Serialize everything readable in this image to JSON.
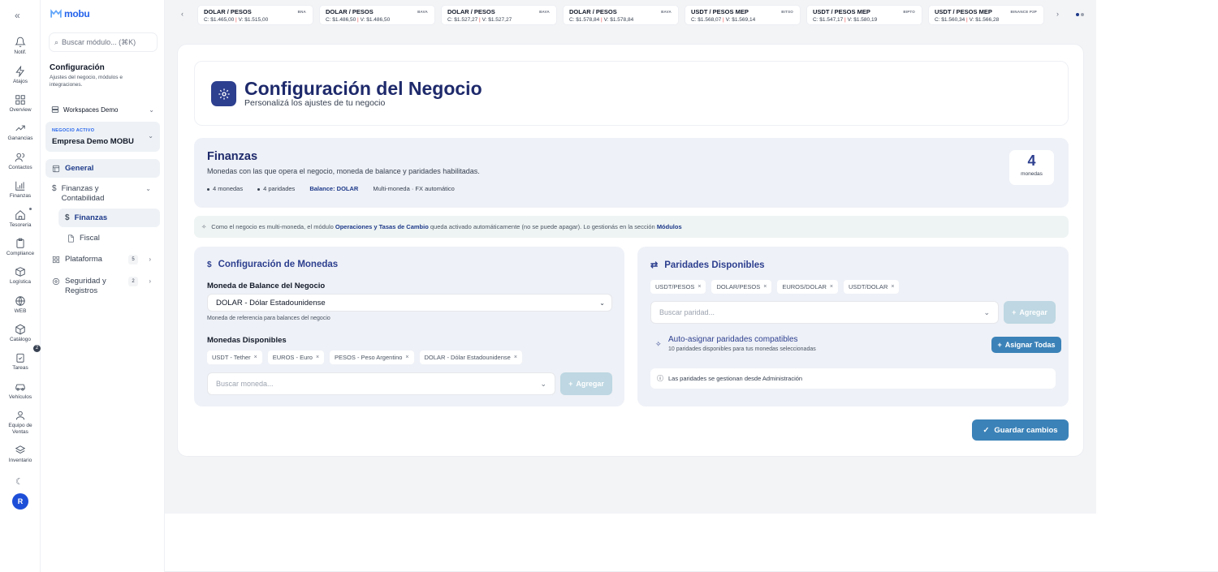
{
  "rail": {
    "items": [
      {
        "label": "Notif.",
        "icon": "bell-icon"
      },
      {
        "label": "Atajos",
        "icon": "zap-icon"
      },
      {
        "label": "Overview",
        "icon": "grid-icon"
      },
      {
        "label": "Ganancias",
        "icon": "trending-icon"
      },
      {
        "label": "Contactos",
        "icon": "users-icon"
      },
      {
        "label": "Finanzas",
        "icon": "chart-icon"
      },
      {
        "label": "Tesorería",
        "icon": "home-icon"
      },
      {
        "label": "Compliance",
        "icon": "clipboard-icon"
      },
      {
        "label": "Logística",
        "icon": "box-icon"
      },
      {
        "label": "WEB",
        "icon": "globe-icon"
      },
      {
        "label": "Catálogo",
        "icon": "package-icon"
      },
      {
        "label": "Tareas",
        "icon": "clipboard-check-icon"
      },
      {
        "label": "Vehículos",
        "icon": "car-icon"
      },
      {
        "label": "Equipo de Ventas",
        "icon": "team-icon"
      },
      {
        "label": "Inventario",
        "icon": "layers-icon"
      }
    ],
    "tasks_badge": "2",
    "avatar_initial": "R"
  },
  "sidebar": {
    "logo": "mobu",
    "search_placeholder": "Buscar módulo... (⌘K)",
    "title": "Configuración",
    "subtitle": "Ajustes del negocio, módulos e integraciones.",
    "workspace": "Workspaces Demo",
    "active_label": "NEGOCIO ACTIVO",
    "active_name": "Empresa Demo MOBU",
    "nav": {
      "general": "General",
      "finanzas_contabilidad": "Finanzas y Contabilidad",
      "finanzas": "Finanzas",
      "fiscal": "Fiscal",
      "plataforma": "Plataforma",
      "plataforma_count": "5",
      "seguridad": "Seguridad y Registros",
      "seguridad_count": "2"
    }
  },
  "ticker": [
    {
      "pair": "DOLAR / PESOS",
      "src": "BNA",
      "buy": "C: $1.465,00",
      "sell": "V: $1.515,00"
    },
    {
      "pair": "DOLAR / PESOS",
      "src": "BAVA",
      "buy": "C: $1.486,50",
      "sell": "V: $1.486,50"
    },
    {
      "pair": "DOLAR / PESOS",
      "src": "BAVA",
      "buy": "C: $1.527,27",
      "sell": "V: $1.527,27"
    },
    {
      "pair": "DOLAR / PESOS",
      "src": "BAVA",
      "buy": "C: $1.578,84",
      "sell": "V: $1.578,84"
    },
    {
      "pair": "USDT / PESOS MEP",
      "src": "BITSO",
      "buy": "C: $1.568,07",
      "sell": "V: $1.569,14"
    },
    {
      "pair": "USDT / PESOS MEP",
      "src": "BIPTO",
      "buy": "C: $1.547,17",
      "sell": "V: $1.580,19"
    },
    {
      "pair": "USDT / PESOS MEP",
      "src": "BINANCE P2P",
      "buy": "C: $1.560,34",
      "sell": "V: $1.566,28"
    }
  ],
  "header": {
    "title": "Configuración del Negocio",
    "subtitle": "Personalizá los ajustes de tu negocio"
  },
  "finanzas": {
    "title": "Finanzas",
    "description": "Monedas con las que opera el negocio, moneda de balance y paridades habilitadas.",
    "chip_monedas": "4 monedas",
    "chip_paridades": "4 paridades",
    "chip_balance": "Balance: DOLAR",
    "chip_multi": "Multi-moneda · FX automático",
    "count_value": "4",
    "count_label": "monedas"
  },
  "info": {
    "pre": "Como el negocio es multi-moneda, el módulo ",
    "module": "Operaciones y Tasas de Cambio",
    "mid": " queda activado automáticamente (no se puede apagar). Lo gestionás en la sección ",
    "section": "Módulos"
  },
  "monedas": {
    "title": "Configuración de Monedas",
    "balance_label": "Moneda de Balance del Negocio",
    "balance_value": "DOLAR - Dólar Estadounidense",
    "balance_hint": "Moneda de referencia para balances del negocio",
    "disponibles_label": "Monedas Disponibles",
    "tags": [
      "USDT - Tether",
      "EUROS - Euro",
      "PESOS - Peso Argentino",
      "DOLAR - Dólar Estadounidense"
    ],
    "search_placeholder": "Buscar moneda...",
    "add_label": "Agregar"
  },
  "paridades": {
    "title": "Paridades Disponibles",
    "tags": [
      "USDT/PESOS",
      "DOLAR/PESOS",
      "EUROS/DOLAR",
      "USDT/DOLAR"
    ],
    "search_placeholder": "Buscar paridad...",
    "add_label": "Agregar",
    "auto_title": "Auto-asignar paridades compatibles",
    "auto_sub": "10 paridades disponibles para tus monedas seleccionadas",
    "assign_label": "Asignar Todas",
    "admin_note": "Las paridades se gestionan desde Administración"
  },
  "save_label": "Guardar cambios",
  "colors": {
    "primary": "#2d3f8f",
    "accent": "#3b82b8",
    "soft": "#eef1f7"
  }
}
